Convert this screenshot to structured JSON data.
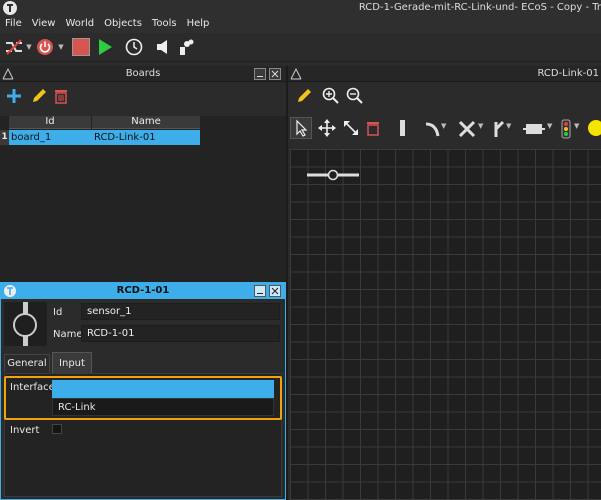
{
  "window": {
    "title": "RCD-1-Gerade-mit-RC-Link-und- ECoS - Copy - Tr"
  },
  "menu": [
    "File",
    "View",
    "World",
    "Objects",
    "Tools",
    "Help"
  ],
  "boards_panel": {
    "title": "Boards",
    "columns": [
      "Id",
      "Name"
    ],
    "rows": [
      {
        "num": "1",
        "id": "board_1",
        "name": "RCD-Link-01"
      }
    ]
  },
  "board_panel": {
    "title": "RCD-Link-01"
  },
  "props": {
    "title": "RCD-1-01",
    "id_label": "Id",
    "id_value": "sensor_1",
    "name_label": "Name",
    "name_value": "RCD-1-01",
    "tabs": [
      "General",
      "Input"
    ],
    "interface_label": "Interface",
    "interface_value": "",
    "interface_options": [
      "RC-Link"
    ],
    "invert_label": "Invert",
    "invert_checked": false
  },
  "colors": {
    "accent": "#3daee9",
    "focus": "#f0a30a",
    "stop": "#d9534f",
    "run": "#2ecc40"
  }
}
